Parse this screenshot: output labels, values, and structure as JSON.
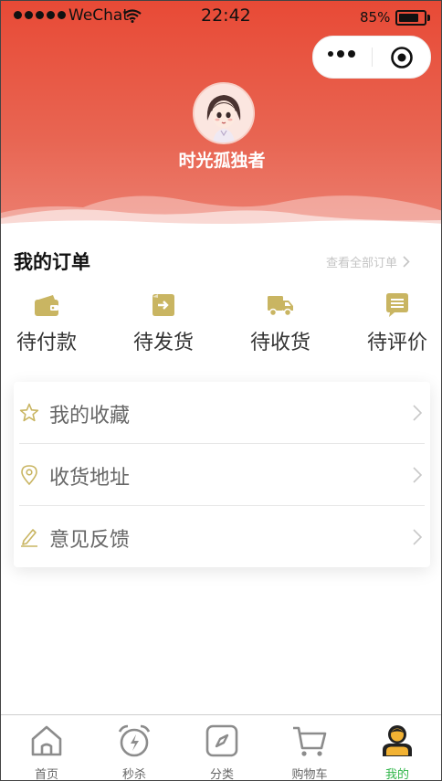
{
  "status_bar": {
    "carrier": "WeChat",
    "time": "22:42",
    "battery": "85%",
    "battery_level": 0.85
  },
  "profile": {
    "username": "时光孤独者"
  },
  "orders": {
    "title": "我的订单",
    "view_all": "查看全部订单",
    "items": [
      {
        "label": "待付款",
        "icon": "wallet-icon"
      },
      {
        "label": "待发货",
        "icon": "ship-out-icon"
      },
      {
        "label": "待收货",
        "icon": "truck-icon"
      },
      {
        "label": "待评价",
        "icon": "comment-icon"
      }
    ]
  },
  "menu": {
    "items": [
      {
        "label": "我的收藏",
        "icon": "star-icon"
      },
      {
        "label": "收货地址",
        "icon": "location-pin-icon"
      },
      {
        "label": "意见反馈",
        "icon": "pencil-icon"
      }
    ]
  },
  "tabbar": {
    "active_index": 4,
    "items": [
      {
        "label": "首页",
        "icon": "home-icon"
      },
      {
        "label": "秒杀",
        "icon": "alarm-clock-icon"
      },
      {
        "label": "分类",
        "icon": "compass-icon"
      },
      {
        "label": "购物车",
        "icon": "cart-icon"
      },
      {
        "label": "我的",
        "icon": "user-icon"
      }
    ]
  },
  "colors": {
    "header_top": "#e84a36",
    "header_bottom": "#ec7f70",
    "icon_gold": "#c9b562",
    "tab_active": "#30b64a",
    "tab_inactive": "#666666"
  }
}
